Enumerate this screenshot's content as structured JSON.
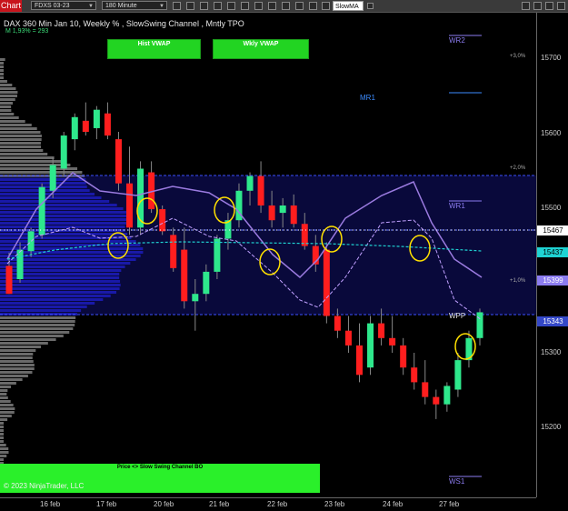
{
  "toolbar": {
    "tab_label": "Chart",
    "instrument": "FDXS 03-23",
    "interval": "180 Minute",
    "indicator_input": "SlowMA"
  },
  "chart": {
    "title": "DAX 360 Min Jan 10, Weekly % , SlowSwing Channel , Mntly TPO",
    "subtitle": "M 1,93% = 293",
    "buttons": {
      "hist_vwap": "Hist VWAP",
      "wkly_vwap": "Wkly VWAP"
    },
    "levels": {
      "wr2": "WR2",
      "mr1": "MR1",
      "wr1": "WR1",
      "wpp": "WPP",
      "ws1": "WS1"
    },
    "percent_labels": {
      "p3": "+3,0%",
      "p2": "+2,0%",
      "p1": "+1,0%"
    },
    "bottom_banner": "Price <> Slow Swing Channel BO",
    "copyright": "© 2023 NinjaTrader, LLC",
    "colors": {
      "bull": "#2ee88c",
      "bear": "#ff1e1e",
      "volume_profile": "#1a1aa8",
      "channel": "#9b7be0",
      "banner": "#2af02a"
    }
  },
  "y_axis": {
    "ticks": [
      "15700",
      "15600",
      "15500",
      "15400",
      "15300",
      "15200"
    ],
    "last_price": "15467",
    "tag_cyan": "15437",
    "tag_purple": "15399",
    "tag_blue": "15343"
  },
  "x_axis": {
    "ticks": [
      "16 feb",
      "17 feb",
      "20 feb",
      "21 feb",
      "22 feb",
      "23 feb",
      "24 feb",
      "27 feb"
    ]
  },
  "chart_data": {
    "type": "candlestick",
    "xlabel": "",
    "ylabel": "",
    "ylim": [
      15130,
      15745
    ],
    "x": [
      "16 feb",
      "17 feb",
      "20 feb",
      "21 feb",
      "22 feb",
      "23 feb",
      "24 feb",
      "27 feb"
    ],
    "candles": [
      {
        "o": 15418,
        "h": 15436,
        "l": 15380,
        "c": 15380
      },
      {
        "o": 15400,
        "h": 15450,
        "l": 15395,
        "c": 15440
      },
      {
        "o": 15438,
        "h": 15470,
        "l": 15430,
        "c": 15465
      },
      {
        "o": 15460,
        "h": 15530,
        "l": 15455,
        "c": 15525
      },
      {
        "o": 15520,
        "h": 15565,
        "l": 15510,
        "c": 15555
      },
      {
        "o": 15550,
        "h": 15600,
        "l": 15540,
        "c": 15595
      },
      {
        "o": 15590,
        "h": 15625,
        "l": 15575,
        "c": 15620
      },
      {
        "o": 15615,
        "h": 15640,
        "l": 15595,
        "c": 15600
      },
      {
        "o": 15605,
        "h": 15635,
        "l": 15590,
        "c": 15630
      },
      {
        "o": 15625,
        "h": 15640,
        "l": 15590,
        "c": 15595
      },
      {
        "o": 15590,
        "h": 15600,
        "l": 15520,
        "c": 15530
      },
      {
        "o": 15530,
        "h": 15580,
        "l": 15460,
        "c": 15470
      },
      {
        "o": 15470,
        "h": 15560,
        "l": 15460,
        "c": 15550
      },
      {
        "o": 15545,
        "h": 15560,
        "l": 15490,
        "c": 15495
      },
      {
        "o": 15495,
        "h": 15500,
        "l": 15460,
        "c": 15465
      },
      {
        "o": 15460,
        "h": 15470,
        "l": 15410,
        "c": 15415
      },
      {
        "o": 15440,
        "h": 15470,
        "l": 15360,
        "c": 15370
      },
      {
        "o": 15370,
        "h": 15400,
        "l": 15330,
        "c": 15380
      },
      {
        "o": 15380,
        "h": 15420,
        "l": 15370,
        "c": 15410
      },
      {
        "o": 15410,
        "h": 15460,
        "l": 15400,
        "c": 15455
      },
      {
        "o": 15455,
        "h": 15490,
        "l": 15440,
        "c": 15480
      },
      {
        "o": 15480,
        "h": 15530,
        "l": 15470,
        "c": 15520
      },
      {
        "o": 15520,
        "h": 15545,
        "l": 15500,
        "c": 15540
      },
      {
        "o": 15540,
        "h": 15560,
        "l": 15490,
        "c": 15500
      },
      {
        "o": 15500,
        "h": 15520,
        "l": 15470,
        "c": 15480
      },
      {
        "o": 15490,
        "h": 15510,
        "l": 15470,
        "c": 15500
      },
      {
        "o": 15500,
        "h": 15515,
        "l": 15470,
        "c": 15475
      },
      {
        "o": 15475,
        "h": 15490,
        "l": 15440,
        "c": 15445
      },
      {
        "o": 15445,
        "h": 15460,
        "l": 15410,
        "c": 15420
      },
      {
        "o": 15440,
        "h": 15450,
        "l": 15340,
        "c": 15350
      },
      {
        "o": 15350,
        "h": 15360,
        "l": 15320,
        "c": 15330
      },
      {
        "o": 15330,
        "h": 15350,
        "l": 15300,
        "c": 15310
      },
      {
        "o": 15310,
        "h": 15340,
        "l": 15260,
        "c": 15270
      },
      {
        "o": 15280,
        "h": 15350,
        "l": 15270,
        "c": 15340
      },
      {
        "o": 15340,
        "h": 15360,
        "l": 15310,
        "c": 15320
      },
      {
        "o": 15320,
        "h": 15350,
        "l": 15300,
        "c": 15310
      },
      {
        "o": 15310,
        "h": 15320,
        "l": 15270,
        "c": 15280
      },
      {
        "o": 15280,
        "h": 15300,
        "l": 15250,
        "c": 15260
      },
      {
        "o": 15260,
        "h": 15290,
        "l": 15230,
        "c": 15240
      },
      {
        "o": 15240,
        "h": 15250,
        "l": 15210,
        "c": 15230
      },
      {
        "o": 15230,
        "h": 15260,
        "l": 15220,
        "c": 15255
      },
      {
        "o": 15250,
        "h": 15300,
        "l": 15240,
        "c": 15290
      },
      {
        "o": 15290,
        "h": 15330,
        "l": 15280,
        "c": 15320
      },
      {
        "o": 15320,
        "h": 15360,
        "l": 15310,
        "c": 15355
      }
    ]
  }
}
